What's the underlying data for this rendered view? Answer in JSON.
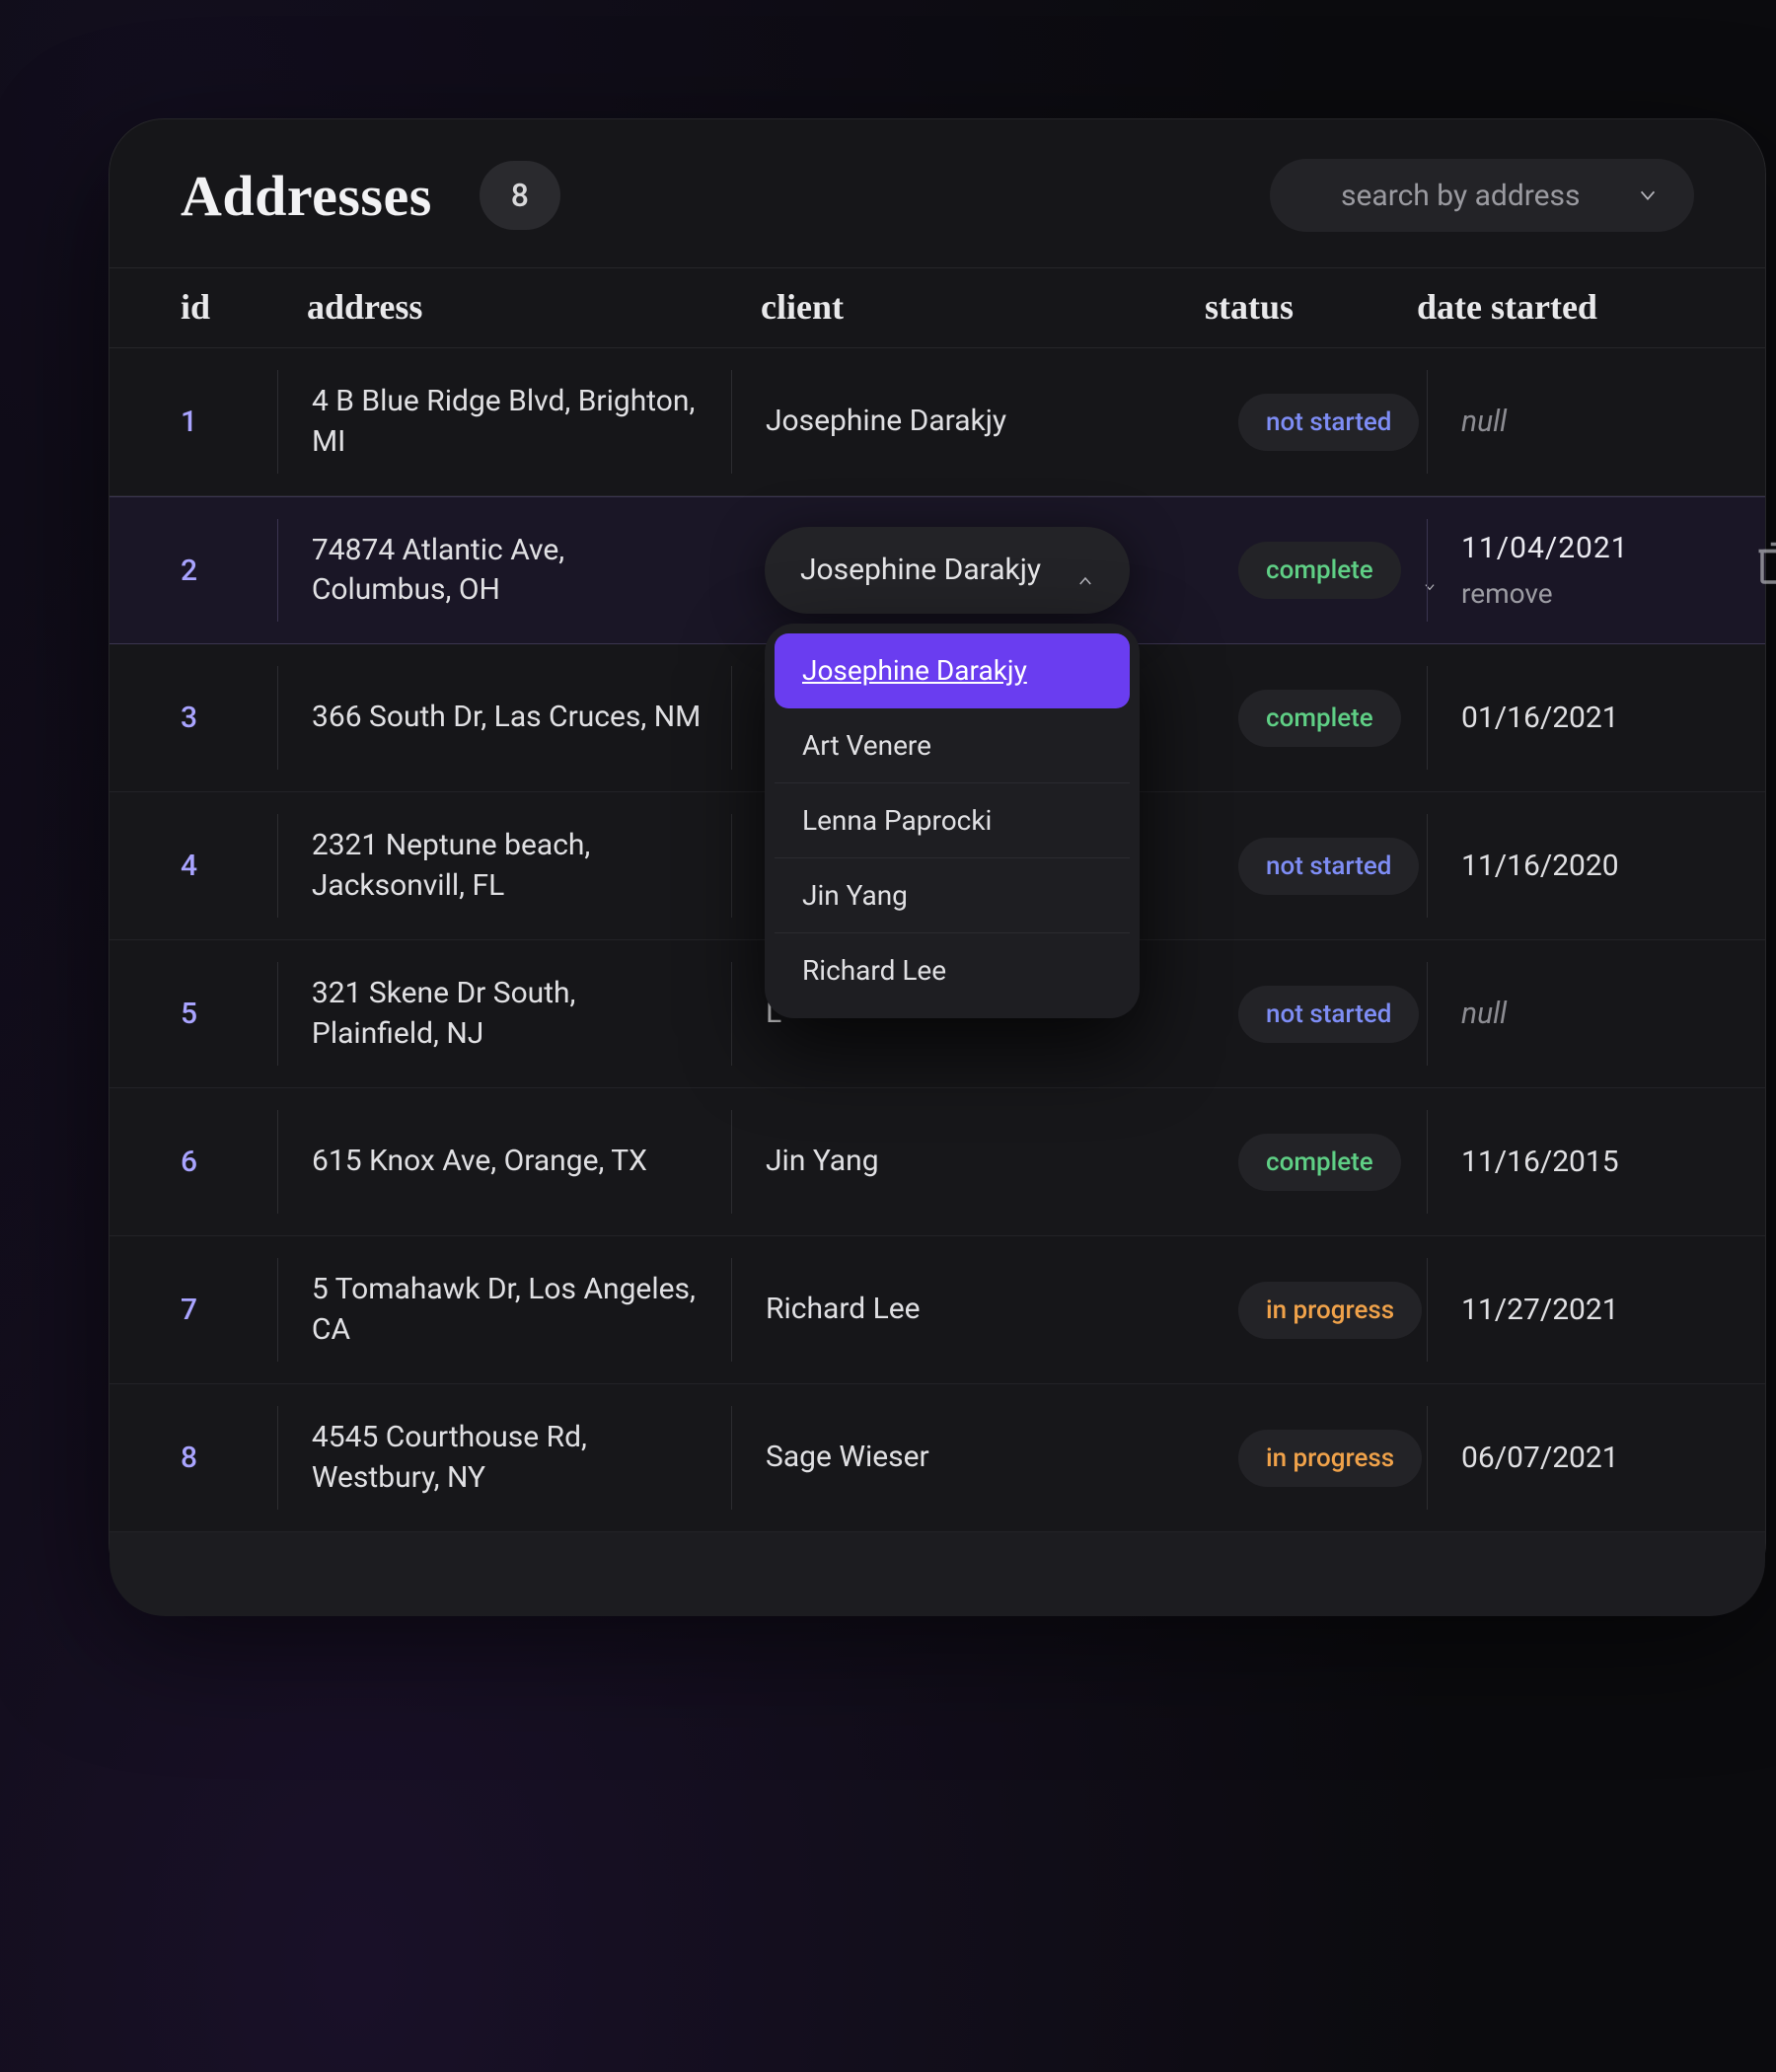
{
  "header": {
    "title": "Addresses",
    "count": "8",
    "search_placeholder": "search by address"
  },
  "columns": {
    "id": "id",
    "address": "address",
    "client": "client",
    "status": "status",
    "date_started": "date started"
  },
  "status_labels": {
    "not_started": "not started",
    "complete": "complete",
    "in_progress": "in progress"
  },
  "null_text": "null",
  "remove_label": "remove",
  "rows": [
    {
      "id": "1",
      "address": "4 B Blue Ridge Blvd, Brighton, MI",
      "client": "Josephine Darakjy",
      "status": "not_started",
      "date": null
    },
    {
      "id": "2",
      "address": "74874 Atlantic Ave, Columbus, OH",
      "client": "Josephine Darakjy",
      "status": "complete",
      "date": "11/04/2021",
      "editing": true
    },
    {
      "id": "3",
      "address": "366 South Dr, Las Cruces, NM",
      "client": "",
      "status": "complete",
      "date": "01/16/2021"
    },
    {
      "id": "4",
      "address": "2321 Neptune beach, Jacksonvill, FL",
      "client": "",
      "status": "not_started",
      "date": "11/16/2020"
    },
    {
      "id": "5",
      "address": "321 Skene Dr South, Plainfield, NJ",
      "client": "L",
      "status": "not_started",
      "date": null
    },
    {
      "id": "6",
      "address": "615 Knox Ave, Orange, TX",
      "client": "Jin Yang",
      "status": "complete",
      "date": "11/16/2015"
    },
    {
      "id": "7",
      "address": "5 Tomahawk Dr, Los Angeles, CA",
      "client": "Richard Lee",
      "status": "in_progress",
      "date": "11/27/2021"
    },
    {
      "id": "8",
      "address": "4545 Courthouse Rd, Westbury, NY",
      "client": "Sage Wieser",
      "status": "in_progress",
      "date": "06/07/2021"
    }
  ],
  "client_options": [
    "Josephine Darakjy",
    "Art Venere",
    "Lenna Paprocki",
    "Jin Yang",
    "Richard Lee"
  ],
  "client_selected_option": "Josephine Darakjy"
}
